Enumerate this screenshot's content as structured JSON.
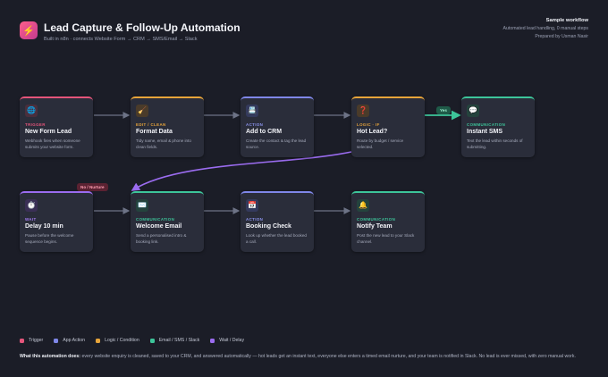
{
  "header": {
    "logo_icon": "lightning-icon",
    "title": "Lead Capture & Follow-Up Automation",
    "subtitle": "Built in n8n · connects Website Form → CRM → SMS/Email → Slack"
  },
  "meta": {
    "title": "Sample workflow",
    "line1": "Automated lead handling, 0 manual steps",
    "line2": "Prepared by Usman Nasir"
  },
  "nodes": [
    {
      "id": "new-form-lead",
      "kind": "trigger",
      "icon": "globe-icon",
      "glyph": "🌐",
      "tag": "TRIGGER",
      "name": "New Form Lead",
      "desc": "Webhook fires when someone submits your website form."
    },
    {
      "id": "format-data",
      "kind": "logic",
      "icon": "broom-icon",
      "glyph": "🧹",
      "tag": "EDIT / CLEAN",
      "name": "Format Data",
      "desc": "Tidy name, email & phone into clean fields."
    },
    {
      "id": "add-to-crm",
      "kind": "app",
      "icon": "database-icon",
      "glyph": "📇",
      "tag": "ACTION",
      "name": "Add to CRM",
      "desc": "Create the contact & tag the lead source."
    },
    {
      "id": "hot-lead",
      "kind": "logic",
      "icon": "question-icon",
      "glyph": "❓",
      "tag": "LOGIC · IF",
      "name": "Hot Lead?",
      "desc": "Route by budget / service selected."
    },
    {
      "id": "instant-sms",
      "kind": "comm",
      "icon": "chat-icon",
      "glyph": "💬",
      "tag": "COMMUNICATION",
      "name": "Instant SMS",
      "desc": "Text the lead within seconds of submitting."
    },
    {
      "id": "delay",
      "kind": "wait",
      "icon": "timer-icon",
      "glyph": "⏱️",
      "tag": "WAIT",
      "name": "Delay 10 min",
      "desc": "Pause before the welcome sequence begins."
    },
    {
      "id": "welcome-email",
      "kind": "comm",
      "icon": "envelope-icon",
      "glyph": "✉️",
      "tag": "COMMUNICATION",
      "name": "Welcome Email",
      "desc": "Send a personalised intro & booking link."
    },
    {
      "id": "booking-check",
      "kind": "app",
      "icon": "calendar-icon",
      "glyph": "📅",
      "tag": "ACTION",
      "name": "Booking Check",
      "desc": "Look up whether the lead booked a call."
    },
    {
      "id": "notify-team",
      "kind": "comm",
      "icon": "bell-icon",
      "glyph": "🔔",
      "tag": "COMMUNICATION",
      "name": "Notify Team",
      "desc": "Post the new lead to your Slack channel."
    }
  ],
  "branches": {
    "yes_label": "Yes",
    "no_label": "No / Nurture"
  },
  "legend": [
    {
      "label": "Trigger",
      "color": "#e5557b"
    },
    {
      "label": "App Action",
      "color": "#7f87e8"
    },
    {
      "label": "Logic / Condition",
      "color": "#e7a43a"
    },
    {
      "label": "Email / SMS / Slack",
      "color": "#3dc59a"
    },
    {
      "label": "Wait / Delay",
      "color": "#9b6cf0"
    }
  ],
  "footer": {
    "lead": "What this automation does:",
    "text": "every website enquiry is cleaned, saved to your CRM, and answered automatically — hot leads get an instant text, everyone else enters a timed email nurture, and your team is notified in Slack. No lead is ever missed, with zero manual work."
  }
}
